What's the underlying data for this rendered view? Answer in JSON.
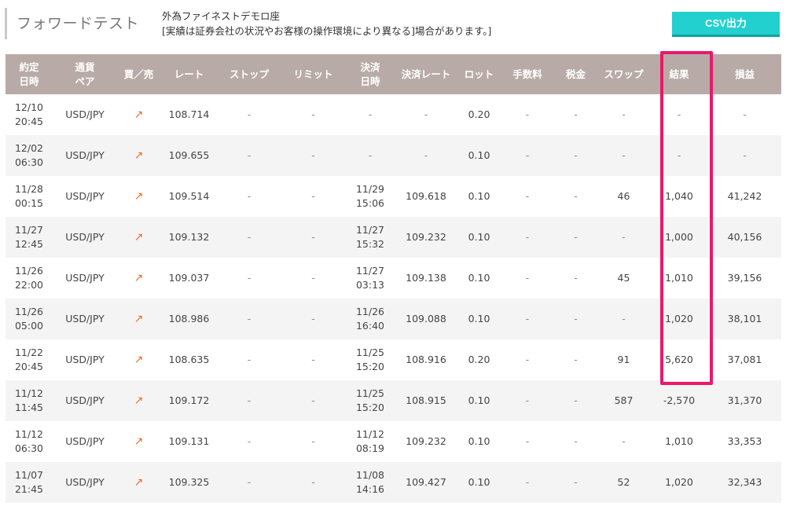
{
  "header": {
    "title": "フォワードテスト",
    "subtitle_line1": "外為ファイネストデモロ座",
    "subtitle_line2": "[実績は証券会社の状況やお客様の操作環境により異なる]場合があります。]",
    "csv_button": "CSV出力"
  },
  "colors": {
    "header_bg": "#b8aba7",
    "csv_button": "#21d0cf",
    "highlight_border": "#e8196b",
    "buy_arrow": "#ee6a2b"
  },
  "columns": [
    {
      "line1": "約定",
      "line2": "日時"
    },
    {
      "line1": "通貨",
      "line2": "ペア"
    },
    {
      "line1": "買／売",
      "line2": ""
    },
    {
      "line1": "レート",
      "line2": ""
    },
    {
      "line1": "ストップ",
      "line2": ""
    },
    {
      "line1": "リミット",
      "line2": ""
    },
    {
      "line1": "決済",
      "line2": "日時"
    },
    {
      "line1": "決済レート",
      "line2": ""
    },
    {
      "line1": "ロット",
      "line2": ""
    },
    {
      "line1": "手数料",
      "line2": ""
    },
    {
      "line1": "税金",
      "line2": ""
    },
    {
      "line1": "スワップ",
      "line2": ""
    },
    {
      "line1": "結果",
      "line2": ""
    },
    {
      "line1": "損益",
      "line2": ""
    }
  ],
  "trade_icon": "up-right-arrow-icon",
  "rows": [
    {
      "date": "12/10",
      "time": "20:45",
      "pair": "USD/JPY",
      "side": "↗",
      "rate": "108.714",
      "stop": "-",
      "limit": "-",
      "close_date": "-",
      "close_time": "",
      "close_rate": "-",
      "lot": "0.20",
      "fee": "-",
      "tax": "-",
      "swap": "-",
      "result": "-",
      "pnl": "-"
    },
    {
      "date": "12/02",
      "time": "06:30",
      "pair": "USD/JPY",
      "side": "↗",
      "rate": "109.655",
      "stop": "-",
      "limit": "-",
      "close_date": "-",
      "close_time": "",
      "close_rate": "-",
      "lot": "0.10",
      "fee": "-",
      "tax": "-",
      "swap": "-",
      "result": "-",
      "pnl": "-"
    },
    {
      "date": "11/28",
      "time": "00:15",
      "pair": "USD/JPY",
      "side": "↗",
      "rate": "109.514",
      "stop": "-",
      "limit": "-",
      "close_date": "11/29",
      "close_time": "15:06",
      "close_rate": "109.618",
      "lot": "0.10",
      "fee": "-",
      "tax": "-",
      "swap": "46",
      "result": "1,040",
      "pnl": "41,242"
    },
    {
      "date": "11/27",
      "time": "12:45",
      "pair": "USD/JPY",
      "side": "↗",
      "rate": "109.132",
      "stop": "-",
      "limit": "-",
      "close_date": "11/27",
      "close_time": "15:32",
      "close_rate": "109.232",
      "lot": "0.10",
      "fee": "-",
      "tax": "-",
      "swap": "-",
      "result": "1,000",
      "pnl": "40,156"
    },
    {
      "date": "11/26",
      "time": "22:00",
      "pair": "USD/JPY",
      "side": "↗",
      "rate": "109.037",
      "stop": "-",
      "limit": "-",
      "close_date": "11/27",
      "close_time": "03:13",
      "close_rate": "109.138",
      "lot": "0.10",
      "fee": "-",
      "tax": "-",
      "swap": "45",
      "result": "1,010",
      "pnl": "39,156"
    },
    {
      "date": "11/26",
      "time": "05:00",
      "pair": "USD/JPY",
      "side": "↗",
      "rate": "108.986",
      "stop": "-",
      "limit": "-",
      "close_date": "11/26",
      "close_time": "16:40",
      "close_rate": "109.088",
      "lot": "0.10",
      "fee": "-",
      "tax": "-",
      "swap": "-",
      "result": "1,020",
      "pnl": "38,101"
    },
    {
      "date": "11/22",
      "time": "20:45",
      "pair": "USD/JPY",
      "side": "↗",
      "rate": "108.635",
      "stop": "-",
      "limit": "-",
      "close_date": "11/25",
      "close_time": "15:20",
      "close_rate": "108.916",
      "lot": "0.20",
      "fee": "-",
      "tax": "-",
      "swap": "91",
      "result": "5,620",
      "pnl": "37,081"
    },
    {
      "date": "11/12",
      "time": "11:45",
      "pair": "USD/JPY",
      "side": "↗",
      "rate": "109.172",
      "stop": "-",
      "limit": "-",
      "close_date": "11/25",
      "close_time": "15:20",
      "close_rate": "108.915",
      "lot": "0.10",
      "fee": "-",
      "tax": "-",
      "swap": "587",
      "result": "-2,570",
      "pnl": "31,370"
    },
    {
      "date": "11/12",
      "time": "06:30",
      "pair": "USD/JPY",
      "side": "↗",
      "rate": "109.131",
      "stop": "-",
      "limit": "-",
      "close_date": "11/12",
      "close_time": "08:19",
      "close_rate": "109.232",
      "lot": "0.10",
      "fee": "-",
      "tax": "-",
      "swap": "-",
      "result": "1,010",
      "pnl": "33,353"
    },
    {
      "date": "11/07",
      "time": "21:45",
      "pair": "USD/JPY",
      "side": "↗",
      "rate": "109.325",
      "stop": "-",
      "limit": "-",
      "close_date": "11/08",
      "close_time": "14:16",
      "close_rate": "109.427",
      "lot": "0.10",
      "fee": "-",
      "tax": "-",
      "swap": "52",
      "result": "1,020",
      "pnl": "32,343"
    }
  ]
}
